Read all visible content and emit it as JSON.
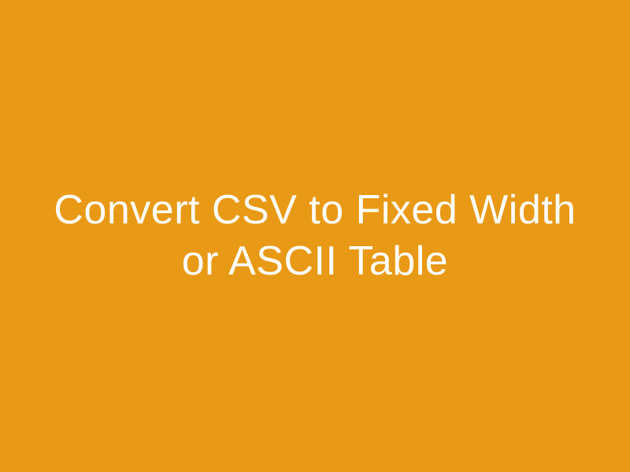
{
  "title": "Convert CSV to Fixed Width or ASCII Table",
  "background_color": "#E89915",
  "text_color": "#FFFFFF"
}
